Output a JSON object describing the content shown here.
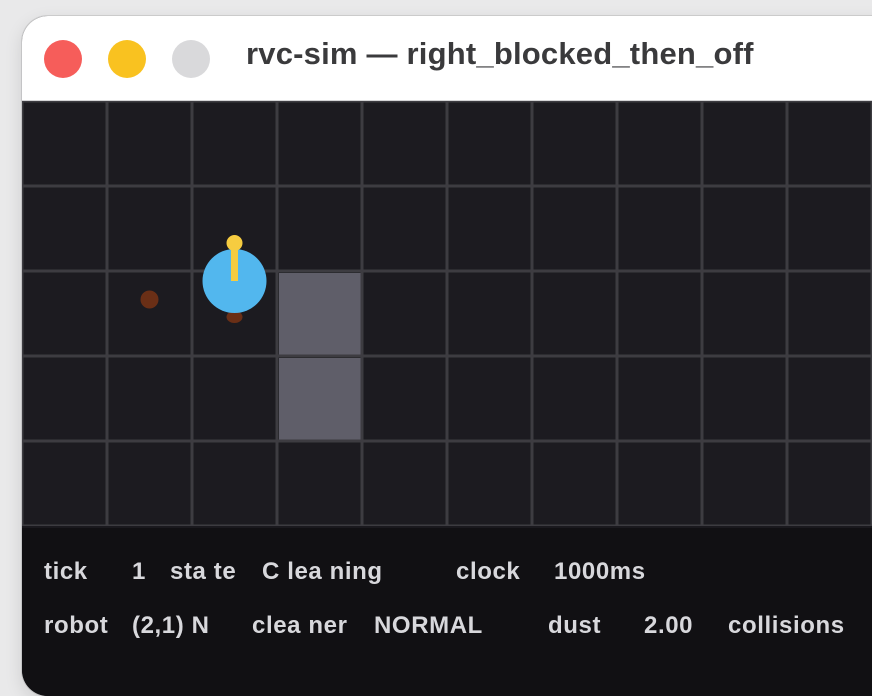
{
  "window": {
    "title": "rvc-sim — right_blocked_then_off"
  },
  "grid": {
    "cols": 10,
    "rows": 5,
    "robot": {
      "x": 2,
      "y": 1,
      "heading": "N"
    },
    "obstacles": [
      {
        "x": 3,
        "y": 2
      },
      {
        "x": 3,
        "y": 3
      }
    ],
    "dust": [
      {
        "x": 1,
        "y": 2
      }
    ],
    "colors": {
      "floor": "#1c1b20",
      "grid_line": "#3d3c41",
      "obstacle": "#5f5e69",
      "robot": "#52b7ee",
      "heading": "#f6cc40",
      "dust": "#6a2f16"
    }
  },
  "status": {
    "tick_label": "tick",
    "tick": "1",
    "state_label": "sta te",
    "state": "C lea ning",
    "clock_label": "clock",
    "clock": "1000ms",
    "robot_label": "robot",
    "robot": "(2,1) N",
    "cleaner_label": "clea ner",
    "cleaner": "NORMAL",
    "dust_label": "dust",
    "dust": "2.00",
    "collisions_label": "collisions"
  }
}
